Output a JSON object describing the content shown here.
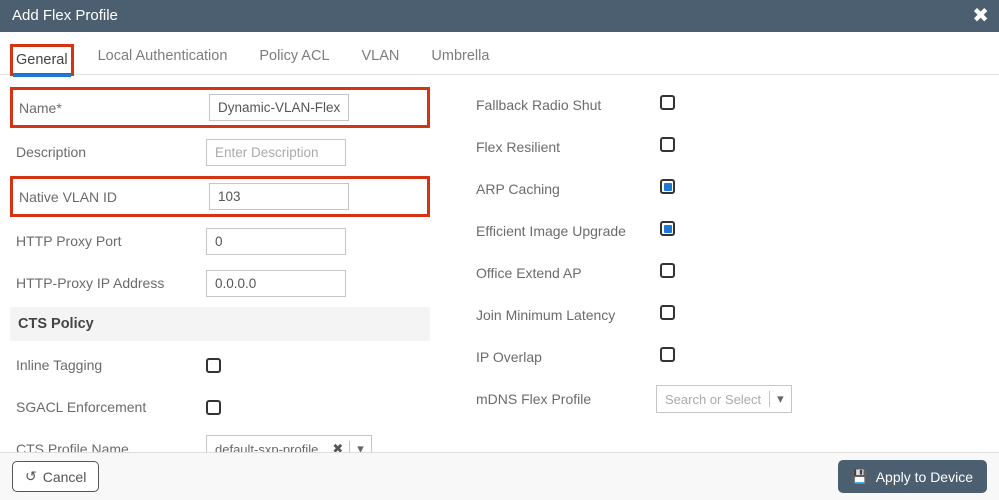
{
  "title": "Add Flex Profile",
  "tabs": {
    "general": "General",
    "local_auth": "Local Authentication",
    "policy_acl": "Policy ACL",
    "vlan": "VLAN",
    "umbrella": "Umbrella"
  },
  "left": {
    "name_label": "Name*",
    "name_value": "Dynamic-VLAN-Flex",
    "desc_label": "Description",
    "desc_placeholder": "Enter Description",
    "native_vlan_label": "Native VLAN ID",
    "native_vlan_value": "103",
    "http_port_label": "HTTP Proxy Port",
    "http_port_value": "0",
    "http_ip_label": "HTTP-Proxy IP Address",
    "http_ip_value": "0.0.0.0",
    "cts_heading": "CTS Policy",
    "inline_tagging_label": "Inline Tagging",
    "sgacl_label": "SGACL Enforcement",
    "cts_profile_label": "CTS Profile Name",
    "cts_profile_value": "default-sxp-profile"
  },
  "right": {
    "fallback_label": "Fallback Radio Shut",
    "flex_resilient_label": "Flex Resilient",
    "arp_caching_label": "ARP Caching",
    "eff_img_label": "Efficient Image Upgrade",
    "office_extend_label": "Office Extend AP",
    "join_min_label": "Join Minimum Latency",
    "ip_overlap_label": "IP Overlap",
    "mdns_label": "mDNS Flex Profile",
    "mdns_placeholder": "Search or Select"
  },
  "footer": {
    "cancel": "Cancel",
    "apply": "Apply to Device"
  }
}
